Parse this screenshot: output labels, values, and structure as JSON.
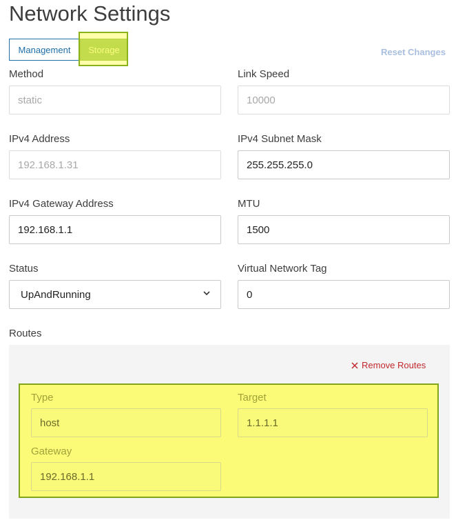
{
  "page": {
    "title": "Network Settings"
  },
  "tabs": [
    {
      "label": "Management",
      "selected": false
    },
    {
      "label": "Storage",
      "selected": true
    }
  ],
  "reset_label": "Reset Changes",
  "fields": {
    "method": {
      "label": "Method",
      "value": "static",
      "disabled": true
    },
    "link_speed": {
      "label": "Link Speed",
      "value": "10000",
      "disabled": true
    },
    "ipv4_address": {
      "label": "IPv4 Address",
      "value": "192.168.1.31",
      "disabled": true
    },
    "ipv4_subnet": {
      "label": "IPv4 Subnet Mask",
      "value": "255.255.255.0"
    },
    "ipv4_gateway": {
      "label": "IPv4 Gateway Address",
      "value": "192.168.1.1"
    },
    "mtu": {
      "label": "MTU",
      "value": "1500"
    },
    "status": {
      "label": "Status",
      "value": "UpAndRunning"
    },
    "vlan": {
      "label": "Virtual Network Tag",
      "value": "0"
    }
  },
  "routes": {
    "label": "Routes",
    "remove_label": "Remove Routes",
    "item": {
      "type": {
        "label": "Type",
        "value": "host"
      },
      "target": {
        "label": "Target",
        "value": "1.1.1.1"
      },
      "gateway": {
        "label": "Gateway",
        "value": "192.168.1.1"
      }
    }
  },
  "colors": {
    "accent": "#1f6fa8",
    "active_tab": "#7ab22e",
    "danger": "#c0282d",
    "highlight": "#fbfb78"
  }
}
